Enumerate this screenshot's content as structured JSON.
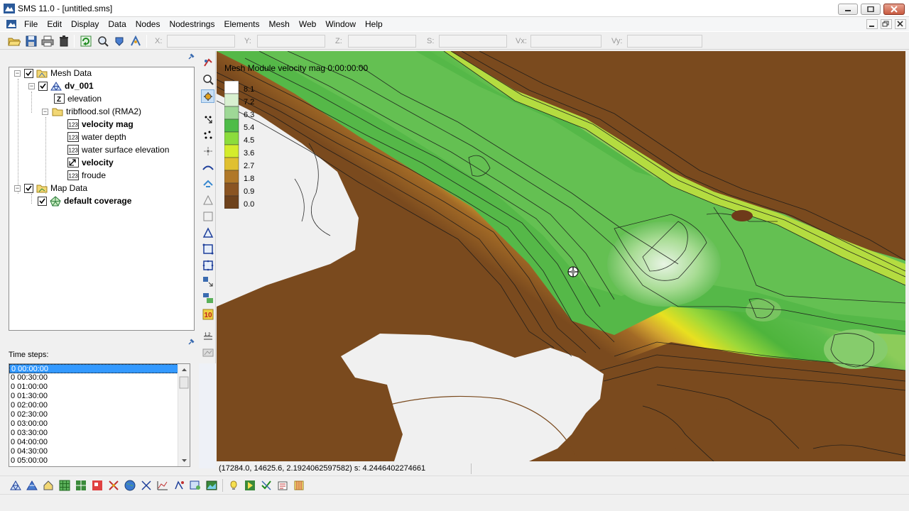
{
  "window": {
    "title": "SMS 11.0 - [untitled.sms]"
  },
  "menu": {
    "items": [
      "File",
      "Edit",
      "Display",
      "Data",
      "Nodes",
      "Nodestrings",
      "Elements",
      "Mesh",
      "Web",
      "Window",
      "Help"
    ]
  },
  "coords": {
    "x_label": "X:",
    "y_label": "Y:",
    "z_label": "Z:",
    "s_label": "S:",
    "vx_label": "Vx:",
    "vy_label": "Vy:",
    "x_value": "",
    "y_value": "",
    "z_value": "",
    "s_value": "",
    "vx_value": "",
    "vy_value": ""
  },
  "tree": {
    "mesh_data": "Mesh Data",
    "mesh": "dv_001",
    "elevation": "elevation",
    "solution": "tribflood.sol (RMA2)",
    "velocity_mag": "velocity mag",
    "water_depth": "water depth",
    "water_surface": "water surface elevation",
    "velocity": "velocity",
    "froude": "froude",
    "map_data": "Map Data",
    "coverage": "default coverage"
  },
  "time_panel": {
    "label": "Time steps:",
    "steps": [
      "0 00:00:00",
      "0 00:30:00",
      "0 01:00:00",
      "0 01:30:00",
      "0 02:00:00",
      "0 02:30:00",
      "0 03:00:00",
      "0 03:30:00",
      "0 04:00:00",
      "0 04:30:00",
      "0 05:00:00"
    ],
    "selected": "0 00:00:00"
  },
  "map": {
    "title": "Mesh Module velocity mag 0:00:00:00",
    "legend": [
      "8.1",
      "7.2",
      "6.3",
      "5.4",
      "4.5",
      "3.6",
      "2.7",
      "1.8",
      "0.9",
      "0.0"
    ],
    "legend_colors": [
      "#ffffff",
      "#d8f0d0",
      "#9ed896",
      "#4ebc48",
      "#8cdc3c",
      "#d4ec2c",
      "#e0c030",
      "#b07828",
      "#8a5422",
      "#6e421c"
    ]
  },
  "status": {
    "text": "(17284.0, 14625.6, 2.1924062597582) s: 4.2446402274661"
  }
}
